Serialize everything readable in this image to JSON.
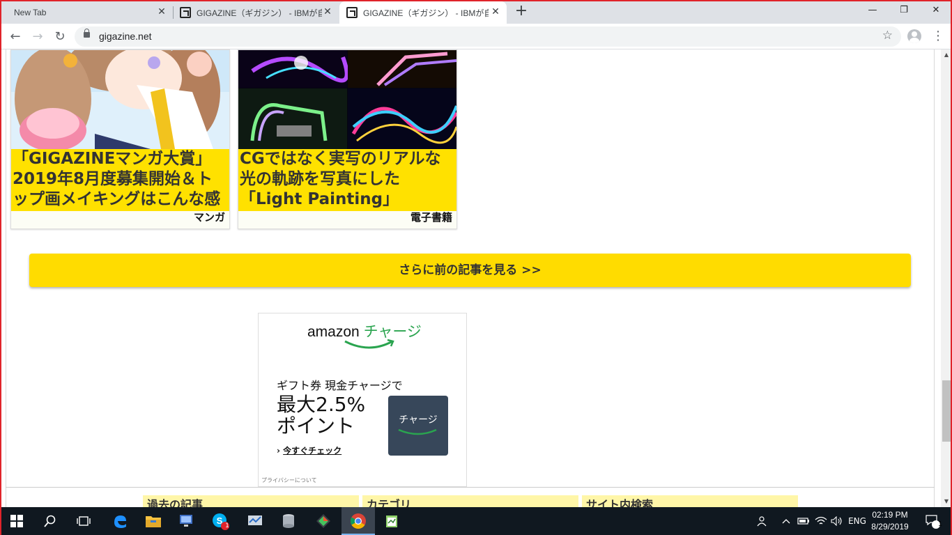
{
  "browser": {
    "tabs": [
      {
        "label": "New Tab",
        "active": false
      },
      {
        "label": "GIGAZINE（ギガジン） - IBMが自",
        "active": false
      },
      {
        "label": "GIGAZINE（ギガジン） - IBMが自",
        "active": true
      }
    ],
    "new_tab_symbol": "+",
    "window_controls": {
      "minimize": "—",
      "maximize": "❐",
      "close": "✕"
    },
    "nav": {
      "back": "←",
      "forward": "→",
      "reload": "↻"
    },
    "url": "gigazine.net",
    "star_symbol": "☆",
    "menu_symbol": "⋮"
  },
  "articles": [
    {
      "title": "「GIGAZINEマンガ大賞」2019年8月度募集開始＆トップ画メイキングはこんな感じ",
      "category": "マンガ"
    },
    {
      "title": "CGではなく実写のリアルな光の軌跡を写真にした「Light Painting」",
      "category": "電子書籍"
    }
  ],
  "more_button": "さらに前の記事を見る >>",
  "ad": {
    "logo_amazon": "amazon",
    "logo_charge": "チャージ",
    "line1": "ギフト券 現金チャージで",
    "big1": "最大2.5%",
    "big2": "ポイント",
    "check_prefix": "›",
    "check": "今すぐチェック",
    "button": "チャージ",
    "privacy": "プライバシーについて"
  },
  "footer_boxes": [
    "過去の記事",
    "カテゴリ",
    "サイト内検索"
  ],
  "taskbar": {
    "time": "02:19 PM",
    "date": "8/29/2019",
    "lang": "ENG",
    "skype_badge": "1",
    "notif_count": "1"
  },
  "colors": {
    "accent_yellow": "#ffe100",
    "button_yellow": "#ffdc00",
    "amazon_green": "#2aa44f",
    "taskbar": "#101820"
  }
}
